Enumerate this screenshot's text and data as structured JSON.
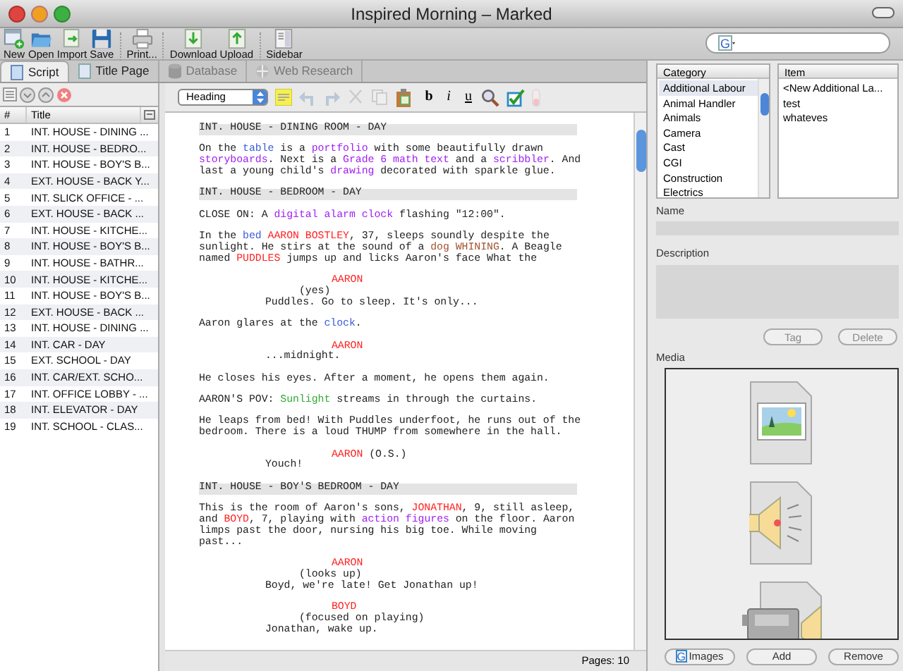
{
  "window": {
    "title": "Inspired Morning – Marked"
  },
  "toolbar": [
    {
      "label": "New",
      "kind": "new"
    },
    {
      "label": "Open",
      "kind": "open"
    },
    {
      "label": "Import",
      "kind": "import"
    },
    {
      "label": "Save",
      "kind": "save"
    },
    {
      "label": "Print...",
      "kind": "print"
    },
    {
      "label": "Download",
      "kind": "download"
    },
    {
      "label": "Upload",
      "kind": "upload"
    },
    {
      "label": "Sidebar",
      "kind": "sidebar"
    }
  ],
  "tabs": [
    {
      "label": "Script",
      "selected": true,
      "disabled": false,
      "kind": "script"
    },
    {
      "label": "Title Page",
      "selected": false,
      "disabled": false,
      "kind": "page"
    },
    {
      "label": "Database",
      "selected": false,
      "disabled": true,
      "kind": "database"
    },
    {
      "label": "Web Research",
      "selected": false,
      "disabled": true,
      "kind": "web"
    }
  ],
  "scene_list": {
    "columns": [
      "#",
      "Title"
    ],
    "rows": [
      {
        "num": "1",
        "title": "INT. HOUSE - DINING ..."
      },
      {
        "num": "2",
        "title": "INT. HOUSE - BEDRO..."
      },
      {
        "num": "3",
        "title": "INT. HOUSE - BOY'S B..."
      },
      {
        "num": "4",
        "title": "EXT. HOUSE - BACK Y..."
      },
      {
        "num": "5",
        "title": "INT. SLICK OFFICE - ..."
      },
      {
        "num": "6",
        "title": "EXT. HOUSE - BACK ..."
      },
      {
        "num": "7",
        "title": "INT. HOUSE - KITCHE..."
      },
      {
        "num": "8",
        "title": "INT. HOUSE - BOY'S B..."
      },
      {
        "num": "9",
        "title": "INT. HOUSE - BATHR..."
      },
      {
        "num": "10",
        "title": "INT. HOUSE - KITCHE..."
      },
      {
        "num": "11",
        "title": "INT. HOUSE - BOY'S B..."
      },
      {
        "num": "12",
        "title": "EXT. HOUSE - BACK ..."
      },
      {
        "num": "13",
        "title": "INT. HOUSE - DINING ..."
      },
      {
        "num": "14",
        "title": "INT. CAR - DAY"
      },
      {
        "num": "15",
        "title": "EXT. SCHOOL - DAY"
      },
      {
        "num": "16",
        "title": "INT. CAR/EXT. SCHO..."
      },
      {
        "num": "17",
        "title": "INT. OFFICE LOBBY - ..."
      },
      {
        "num": "18",
        "title": "INT. ELEVATOR - DAY"
      },
      {
        "num": "19",
        "title": "INT. SCHOOL - CLAS..."
      }
    ]
  },
  "editor": {
    "style_select": "Heading",
    "format_buttons": [
      "b",
      "i",
      "u"
    ],
    "status": "Pages: 10",
    "blocks": [
      {
        "kind": "heading",
        "segments": [
          {
            "text": "INT. HOUSE - DINING ROOM - DAY"
          }
        ]
      },
      {
        "kind": "action",
        "segments": [
          {
            "text": "On the "
          },
          {
            "text": "table",
            "color": "#3a5bd9"
          },
          {
            "text": " is a "
          },
          {
            "text": "portfolio",
            "color": "#a020f0"
          },
          {
            "text": " with some beautifully drawn "
          },
          {
            "text": "storyboards",
            "color": "#a020f0"
          },
          {
            "text": ". Next is a "
          },
          {
            "text": "Grade 6 math text",
            "color": "#a020f0"
          },
          {
            "text": " and a "
          },
          {
            "text": "scribbler",
            "color": "#a020f0"
          },
          {
            "text": ". And last a young child's "
          },
          {
            "text": "drawing",
            "color": "#a020f0"
          },
          {
            "text": " decorated with sparkle glue."
          }
        ]
      },
      {
        "kind": "heading",
        "segments": [
          {
            "text": "INT. HOUSE - BEDROOM - DAY"
          }
        ]
      },
      {
        "kind": "action",
        "segments": [
          {
            "text": "CLOSE ON: A "
          },
          {
            "text": "digital alarm clock",
            "color": "#a020f0"
          },
          {
            "text": " flashing \"12:00\"."
          }
        ]
      },
      {
        "kind": "action",
        "segments": [
          {
            "text": "In the "
          },
          {
            "text": "bed ",
            "color": "#3a5bd9"
          },
          {
            "text": "AARON BOSTLEY",
            "color": "#ff2020"
          },
          {
            "text": ", 37, sleeps soundly despite the sunlight. He stirs at the sound of a "
          },
          {
            "text": "dog WHINING",
            "color": "#a0522d"
          },
          {
            "text": ". A Beagle named "
          },
          {
            "text": "PUDDLES",
            "color": "#ff2020"
          },
          {
            "text": " jumps up and licks Aaron's face What the"
          }
        ]
      },
      {
        "kind": "character",
        "segments": [
          {
            "text": "AARON",
            "color": "#ff2020"
          }
        ]
      },
      {
        "kind": "parenthetical",
        "segments": [
          {
            "text": "(yes)"
          }
        ]
      },
      {
        "kind": "dialogue",
        "segments": [
          {
            "text": "Puddles. Go to sleep. It's only..."
          }
        ]
      },
      {
        "kind": "action",
        "segments": [
          {
            "text": "Aaron glares at the "
          },
          {
            "text": "clock",
            "color": "#3a5bd9"
          },
          {
            "text": "."
          }
        ]
      },
      {
        "kind": "character",
        "segments": [
          {
            "text": "AARON",
            "color": "#ff2020"
          }
        ]
      },
      {
        "kind": "dialogue",
        "segments": [
          {
            "text": "...midnight."
          }
        ]
      },
      {
        "kind": "action",
        "segments": [
          {
            "text": "He closes his eyes. After a moment, he opens them again."
          }
        ]
      },
      {
        "kind": "action",
        "segments": [
          {
            "text": "AARON'S POV: "
          },
          {
            "text": "Sunlight",
            "color": "#33aa33"
          },
          {
            "text": " streams in through the curtains."
          }
        ]
      },
      {
        "kind": "action",
        "segments": [
          {
            "text": "He leaps from bed! With Puddles underfoot, he runs out of the bedroom. There is a loud THUMP from somewhere in the hall."
          }
        ]
      },
      {
        "kind": "character",
        "segments": [
          {
            "text": "AARON",
            "color": "#ff2020"
          },
          {
            "text": " (O.S.)"
          }
        ]
      },
      {
        "kind": "dialogue",
        "segments": [
          {
            "text": "Youch!"
          }
        ]
      },
      {
        "kind": "heading",
        "segments": [
          {
            "text": "INT. HOUSE - BOY'S BEDROOM - DAY"
          }
        ]
      },
      {
        "kind": "action",
        "segments": [
          {
            "text": "This is the room of Aaron's sons, "
          },
          {
            "text": "JONATHAN",
            "color": "#ff2020"
          },
          {
            "text": ", 9, still asleep, and "
          },
          {
            "text": "BOYD",
            "color": "#ff2020"
          },
          {
            "text": ", 7, playing with "
          },
          {
            "text": "action figures",
            "color": "#a020f0"
          },
          {
            "text": " on the floor. Aaron limps past the door, nursing his big toe. While moving past..."
          }
        ]
      },
      {
        "kind": "character",
        "segments": [
          {
            "text": "AARON",
            "color": "#ff2020"
          }
        ]
      },
      {
        "kind": "parenthetical",
        "segments": [
          {
            "text": "(looks up)"
          }
        ]
      },
      {
        "kind": "dialogue",
        "segments": [
          {
            "text": "Boyd, we're late! Get Jonathan up!"
          }
        ]
      },
      {
        "kind": "character",
        "segments": [
          {
            "text": "BOYD",
            "color": "#ff2020"
          }
        ]
      },
      {
        "kind": "parenthetical",
        "segments": [
          {
            "text": "(focused on playing)"
          }
        ]
      },
      {
        "kind": "dialogue",
        "segments": [
          {
            "text": "Jonathan, wake up."
          }
        ]
      }
    ]
  },
  "search_field": {
    "engine_glyph": "G"
  },
  "database": {
    "category_heading": "Category",
    "categories": [
      {
        "label": "Additional Labour",
        "selected": true
      },
      {
        "label": "Animal Handler",
        "selected": false
      },
      {
        "label": "Animals",
        "selected": false
      },
      {
        "label": "Camera",
        "selected": false
      },
      {
        "label": "Cast",
        "selected": false
      },
      {
        "label": "CGI",
        "selected": false
      },
      {
        "label": "Construction",
        "selected": false
      },
      {
        "label": "Electrics",
        "selected": false
      }
    ],
    "item_heading": "Item",
    "items": [
      "<New Additional La...",
      "test",
      "whateves"
    ],
    "name_label": "Name",
    "description_label": "Description",
    "tag_button": "Tag",
    "delete_button": "Delete",
    "media_label": "Media",
    "media": [
      {
        "kind": "image"
      },
      {
        "kind": "sound"
      },
      {
        "kind": "video"
      }
    ],
    "media_buttons": [
      {
        "label": "Images",
        "kind": "images",
        "glyph": "G"
      },
      {
        "label": "Add",
        "kind": "plain"
      },
      {
        "label": "Remove",
        "kind": "plain"
      }
    ]
  }
}
